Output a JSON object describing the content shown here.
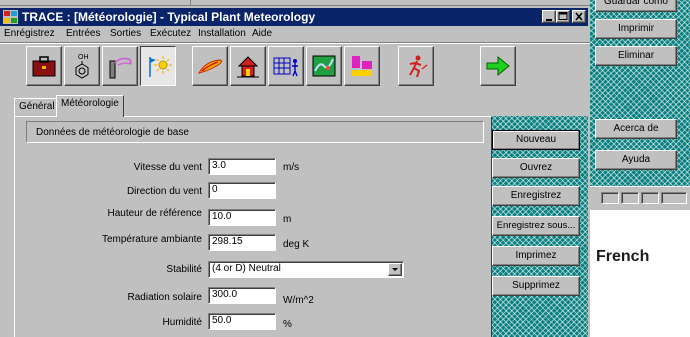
{
  "background_window": {
    "buttons": [
      "Guardar como",
      "Imprimir",
      "Eliminar",
      "Acerca de",
      "Ayuda"
    ]
  },
  "annotation": "French",
  "window": {
    "title": "TRACE : [Météorologie] - Typical Plant Meteorology",
    "caption_buttons": [
      "minimize",
      "maximize",
      "close"
    ]
  },
  "menu": [
    "Enrégistrez",
    "Entrées",
    "Sorties",
    "Exécutez",
    "Installation",
    "Aide"
  ],
  "toolbar": {
    "icons": [
      "briefcase-icon",
      "chemical-structure-icon",
      "stack-emission-icon",
      "wind-sun-icon",
      "plume-icon",
      "house-icon",
      "grid-person-icon",
      "map-icon",
      "blocks-icon",
      "running-person-icon",
      "next-arrow-icon"
    ],
    "pressed": "wind-sun-icon"
  },
  "tabs": [
    "Général",
    "Météorologie"
  ],
  "active_tab": "Météorologie",
  "section_title": "Données de météorologie de base",
  "fields": {
    "wind_speed": {
      "label": "Vitesse du vent",
      "value": "3.0",
      "unit": "m/s"
    },
    "wind_direction": {
      "label": "Direction du vent",
      "value": "0",
      "unit": ""
    },
    "ref_height": {
      "label": "Hauteur de référence",
      "value": "10.0",
      "unit": "m"
    },
    "ambient_temp": {
      "label": "Température ambiante",
      "value": "298.15",
      "unit": "deg K"
    },
    "stability": {
      "label": "Stabilité",
      "value": "(4 or D) Neutral"
    },
    "solar_radiation": {
      "label": "Radiation solaire",
      "value": "300.0",
      "unit": "W/m^2"
    },
    "humidity": {
      "label": "Humidité",
      "value": "50.0",
      "unit": "%"
    }
  },
  "side_buttons": {
    "new": "Nouveau",
    "open": "Ouvrez",
    "save": "Enregistrez",
    "save_as": "Enregistrez sous...",
    "print": "Imprimez",
    "delete": "Supprimez"
  },
  "colors": {
    "title_bar": "#0a246a",
    "teal_panel": "#0a7f80",
    "face": "#c0c0c0"
  }
}
